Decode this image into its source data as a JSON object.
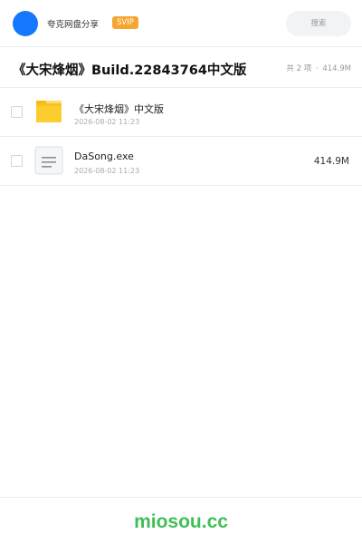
{
  "topbar": {
    "share_name": "夸克网盘分享",
    "svip_label": "SVIP",
    "search_label": "搜索"
  },
  "header": {
    "title": "《大宋烽烟》Build.22843764中文版",
    "item_count": "共 2 项",
    "separator": "·",
    "total_size": "414.9M"
  },
  "files": [
    {
      "name": "《大宋烽烟》中文版",
      "date": "2026-08-02 11:23",
      "size": "",
      "icon": "folder-icon"
    },
    {
      "name": "DaSong.exe",
      "date": "2026-08-02 11:23",
      "size": "414.9M",
      "icon": "file-icon"
    }
  ],
  "footer": {
    "brand": "miosou.cc"
  },
  "colors": {
    "avatar": "#1677ff",
    "svip": "#f5a531",
    "folder": "#f8c21a",
    "brand": "#3fbf56"
  }
}
